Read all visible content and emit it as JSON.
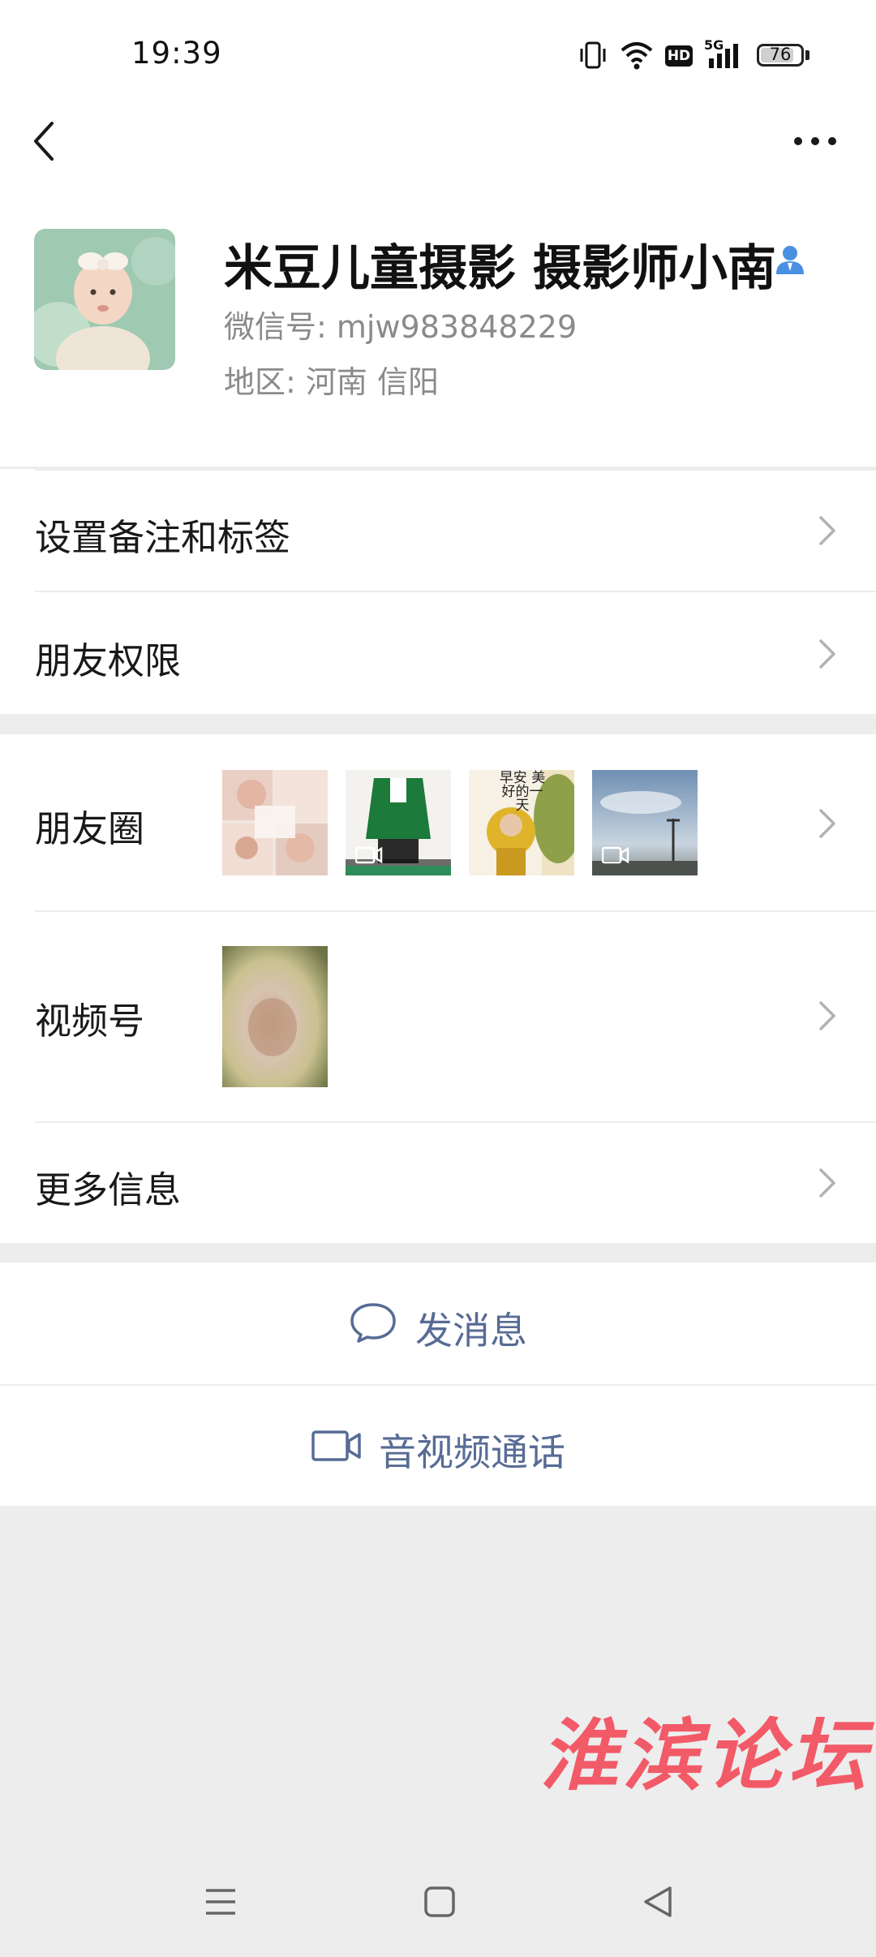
{
  "status_bar": {
    "time": "19:39",
    "battery": "76",
    "network": "5G",
    "hd_badge": "HD"
  },
  "profile": {
    "name": "米豆儿童摄影 摄影师小南",
    "wechat_id": "微信号: mjw983848229",
    "region": "地区: 河南  信阳"
  },
  "menu": {
    "remark": "设置备注和标签",
    "permissions": "朋友权限",
    "moments": "朋友圈",
    "channels": "视频号",
    "more_info": "更多信息"
  },
  "moments_photo_text": "早安 美好的一天",
  "actions": {
    "message": "发消息",
    "call": "音视频通话"
  },
  "watermark": "淮滨论坛",
  "colors": {
    "accent": "#576b95",
    "background": "#ededed",
    "watermark": "#f25a68",
    "verified_icon": "#4a90e2"
  },
  "icons": [
    "back-icon",
    "more-icon",
    "verified-icon",
    "chevron-right-icon",
    "chat-bubble-icon",
    "video-camera-icon",
    "menu-key-icon",
    "home-key-icon",
    "back-key-icon"
  ]
}
